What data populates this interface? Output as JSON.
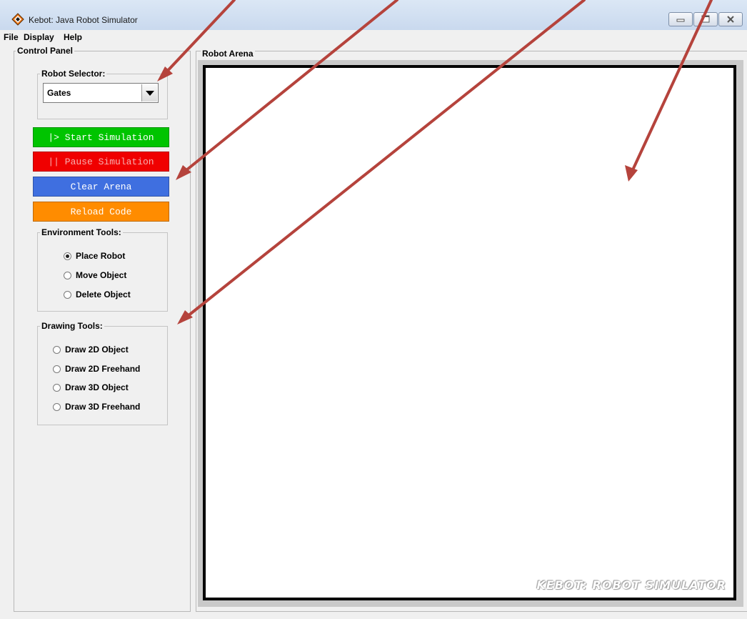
{
  "window": {
    "title": "Kebot: Java Robot Simulator",
    "icon": "kebot-app-icon",
    "buttons": [
      "minimize",
      "maximize",
      "close"
    ]
  },
  "menubar": {
    "items": [
      {
        "label": "File"
      },
      {
        "label": "Display"
      },
      {
        "label": "Help"
      }
    ]
  },
  "control_panel": {
    "title": "Control Panel",
    "robot_selector": {
      "title": "Robot Selector:",
      "selected": "Gates"
    },
    "buttons": {
      "start": {
        "label": "|> Start Simulation",
        "color": "#00c400",
        "text_color": "#ffffff"
      },
      "pause": {
        "label": "|| Pause Simulation",
        "color": "#f00000",
        "text_color": "#f7b0b0"
      },
      "clear": {
        "label": "Clear Arena",
        "color": "#3f6fe0",
        "text_color": "#ffffff"
      },
      "reload": {
        "label": "Reload Code",
        "color": "#ff8c00",
        "text_color": "#ffffff"
      }
    },
    "environment_tools": {
      "title": "Environment Tools:",
      "options": [
        {
          "label": "Place Robot",
          "checked": true
        },
        {
          "label": "Move Object",
          "checked": false
        },
        {
          "label": "Delete Object",
          "checked": false
        }
      ]
    },
    "drawing_tools": {
      "title": "Drawing Tools:",
      "options": [
        {
          "label": "Draw 2D Object",
          "checked": false
        },
        {
          "label": "Draw 2D Freehand",
          "checked": false
        },
        {
          "label": "Draw 3D Object",
          "checked": false
        },
        {
          "label": "Draw 3D Freehand",
          "checked": false
        }
      ]
    }
  },
  "robot_arena": {
    "title": "Robot Arena",
    "watermark": "KEBOT: ROBOT SIMULATOR"
  },
  "annotation": {
    "arrow_color": "#b5433c"
  }
}
